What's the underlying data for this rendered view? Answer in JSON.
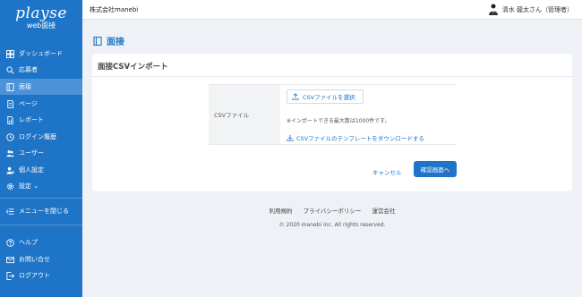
{
  "sidebar": {
    "logo": "playse",
    "logo_sub": "web面接",
    "items": [
      {
        "label": "ダッシュボード",
        "icon": "dashboard-icon"
      },
      {
        "label": "応募者",
        "icon": "search-user-icon"
      },
      {
        "label": "面接",
        "icon": "book-icon"
      },
      {
        "label": "ページ",
        "icon": "page-icon"
      },
      {
        "label": "レポート",
        "icon": "report-icon"
      },
      {
        "label": "ログイン履歴",
        "icon": "clock-icon"
      },
      {
        "label": "ユーザー",
        "icon": "users-icon"
      },
      {
        "label": "個人設定",
        "icon": "person-settings-icon"
      },
      {
        "label": "設定 ⌄",
        "icon": "gear-icon"
      }
    ],
    "collapse_label": "メニューを閉じる",
    "bottom_items": [
      {
        "label": "ヘルプ",
        "icon": "help-icon"
      },
      {
        "label": "お問い合せ",
        "icon": "mail-icon"
      },
      {
        "label": "ログアウト",
        "icon": "logout-icon"
      }
    ]
  },
  "topbar": {
    "company": "株式会社manebi",
    "user": "清水 龍太さん（管理者）"
  },
  "page": {
    "title": "面接"
  },
  "card": {
    "title": "面接CSVインポート",
    "field_label": "CSVファイル",
    "file_button": "CSVファイルを選択",
    "note": "※インポートできる最大数は1000件です。",
    "download_link": "CSVファイルのテンプレートをダウンロードする",
    "cancel": "キャンセル",
    "confirm": "確認画面へ"
  },
  "footer": {
    "links": [
      "利用規約",
      "プライバシーポリシー",
      "運営会社"
    ],
    "copyright": "© 2020 manebi inc. All rights reserved."
  },
  "colors": {
    "brand": "#1e74c7",
    "active_nav": "#4b92d8",
    "background": "#eef1f6"
  }
}
